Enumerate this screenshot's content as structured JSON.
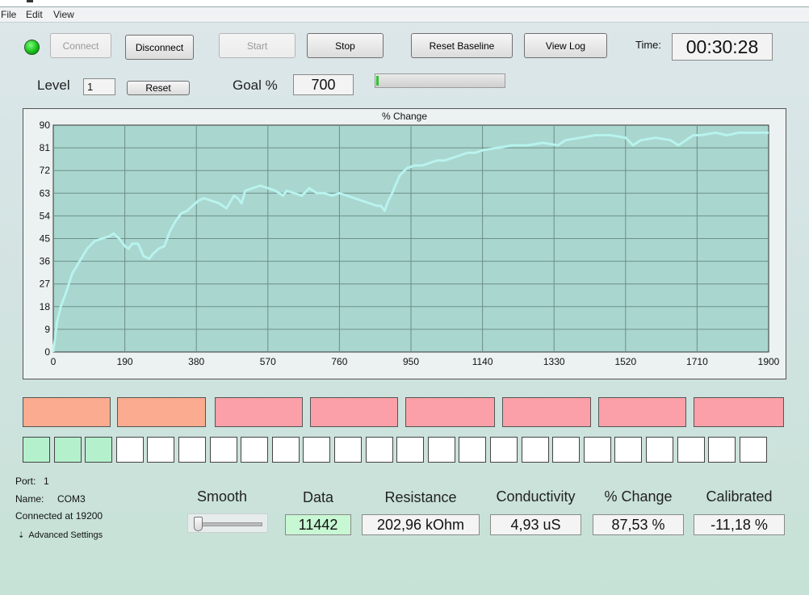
{
  "menu": {
    "file": "File",
    "edit": "Edit",
    "view": "View"
  },
  "toolbar": {
    "connect": "Connect",
    "disconnect": "Disconnect",
    "start": "Start",
    "stop": "Stop",
    "reset_baseline": "Reset Baseline",
    "view_log": "View Log",
    "time_label": "Time:",
    "time_value": "00:30:28"
  },
  "level": {
    "label": "Level",
    "value": "1",
    "reset": "Reset"
  },
  "goal": {
    "label": "Goal %",
    "value": "700",
    "progress": 0.01
  },
  "colors": {
    "status_led": "#11b811",
    "plot_bg": "#a9d6ce",
    "plot_line": "#b8f3ee",
    "tile_orange": "#fbab8f",
    "tile_pink": "#fba0a8",
    "square_green": "#b4f0cc",
    "data_green": "#c8f7d4"
  },
  "chart_data": {
    "type": "line",
    "title": "% Change",
    "xlabel": "",
    "ylabel": "",
    "xlim": [
      0,
      1900
    ],
    "ylim": [
      0,
      90
    ],
    "x_ticks": [
      "0",
      "190",
      "380",
      "570",
      "760",
      "950",
      "1140",
      "1330",
      "1520",
      "1710",
      "1900"
    ],
    "y_ticks": [
      "0",
      "9",
      "18",
      "27",
      "36",
      "45",
      "54",
      "63",
      "72",
      "81",
      "90"
    ],
    "grid": true,
    "series": [
      {
        "x": [
          0,
          5,
          10,
          20,
          35,
          50,
          70,
          90,
          110,
          130,
          150,
          160,
          175,
          190,
          200,
          210,
          225,
          240,
          255,
          265,
          280,
          295,
          310,
          325,
          340,
          355,
          370,
          385,
          400,
          420,
          440,
          460,
          480,
          490,
          500,
          510,
          530,
          550,
          570,
          590,
          610,
          620,
          640,
          660,
          680,
          700,
          720,
          740,
          760,
          780,
          800,
          820,
          840,
          860,
          870,
          880,
          890,
          900,
          920,
          940,
          960,
          980,
          1000,
          1020,
          1040,
          1060,
          1080,
          1100,
          1120,
          1140,
          1180,
          1220,
          1260,
          1300,
          1340,
          1360,
          1400,
          1440,
          1480,
          1520,
          1540,
          1560,
          1600,
          1640,
          1660,
          1700,
          1720,
          1760,
          1790,
          1820,
          1860,
          1900
        ],
        "y": [
          0,
          6,
          12,
          18,
          24,
          31,
          36,
          41,
          44,
          45,
          46,
          47,
          45,
          42,
          41,
          43,
          43,
          38,
          37,
          39,
          41,
          42,
          48,
          52,
          55,
          56,
          58,
          60,
          61,
          60,
          59,
          57,
          62,
          61,
          59,
          64,
          65,
          66,
          65,
          64,
          62,
          64,
          63,
          62,
          65,
          63,
          63,
          62,
          63,
          62,
          61,
          60,
          59,
          58,
          58,
          56,
          60,
          63,
          70,
          73,
          74,
          74,
          75,
          76,
          76,
          77,
          78,
          79,
          79,
          80,
          81,
          82,
          82,
          83,
          82,
          84,
          85,
          86,
          86,
          85,
          82,
          84,
          85,
          84,
          82,
          86,
          86,
          87,
          86,
          87,
          87,
          87
        ]
      }
    ]
  },
  "indicators": {
    "tiles": [
      "orange",
      "orange",
      "pink",
      "pink",
      "pink",
      "pink",
      "pink",
      "pink"
    ],
    "squares_lit": 3,
    "squares_total": 24
  },
  "connection": {
    "port_label": "Port:",
    "port": "1",
    "name_label": "Name:",
    "name": "COM3",
    "status": "Connected at 19200",
    "advanced": "Advanced Settings"
  },
  "readouts": {
    "smooth_label": "Smooth",
    "smooth_value": 0,
    "data_label": "Data",
    "data_value": "11442",
    "resistance_label": "Resistance",
    "resistance_value": "202,96 kOhm",
    "conductivity_label": "Conductivity",
    "conductivity_value": "4,93 uS",
    "change_label": "% Change",
    "change_value": "87,53 %",
    "calibrated_label": "Calibrated",
    "calibrated_value": "-11,18 %"
  }
}
